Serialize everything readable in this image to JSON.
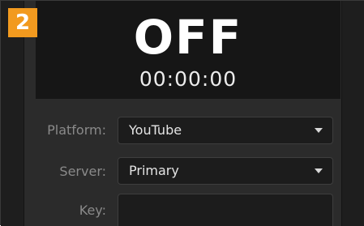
{
  "step": {
    "number": "2",
    "color": "#f29a1f"
  },
  "status": {
    "state": "OFF",
    "timecode": "00:00:00"
  },
  "form": {
    "platform": {
      "label": "Platform:",
      "value": "YouTube"
    },
    "server": {
      "label": "Server:",
      "value": "Primary"
    },
    "key": {
      "label": "Key:",
      "value": ""
    }
  },
  "icons": {
    "dropdown": "chevron-down-icon"
  }
}
